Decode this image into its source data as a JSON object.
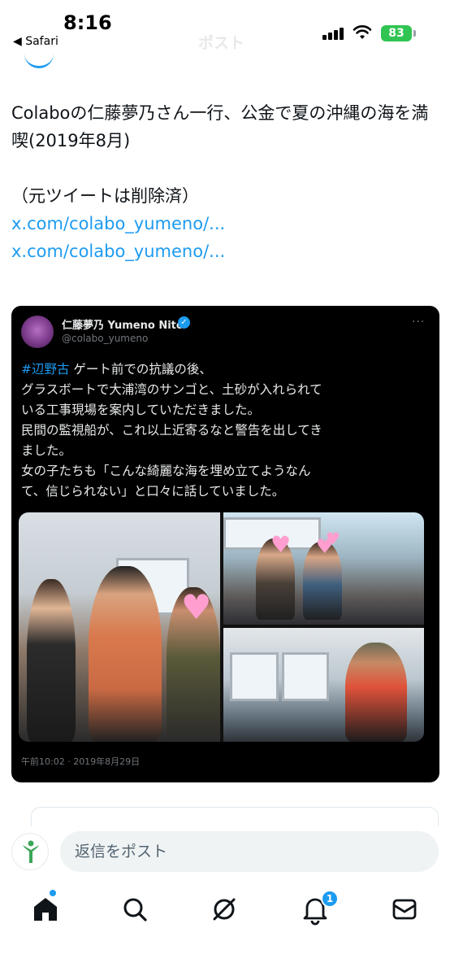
{
  "status_bar": {
    "time": "8:16",
    "back_app": "◀ Safari",
    "battery": "83"
  },
  "header": {
    "title": "ポスト"
  },
  "tweet": {
    "text_line1": "Colaboの仁藤夢乃さん一行、公金で夏の沖縄の海を満喫(2019年8月)",
    "text_line2": "（元ツイートは削除済）",
    "link1": "x.com/colabo_yumeno/...",
    "link2": "x.com/colabo_yumeno/..."
  },
  "embedded_tweet": {
    "name": "仁藤夢乃 Yumeno Nito",
    "handle": "@colabo_yumeno",
    "hashtag": "#辺野古",
    "line1_rest": " ゲート前での抗議の後、",
    "line2": "グラスボートで大浦湾のサンゴと、土砂が入れられて",
    "line3": "いる工事現場を案内していただきました。",
    "line4": "民間の監視船が、これ以上近寄るなと警告を出してき",
    "line5": "ました。",
    "line6": "女の子たちも「こんな綺麗な海を埋め立てようなん",
    "line7": "て、信じられない」と口々に話していました。",
    "timestamp": "午前10:02 · 2019年8月29日",
    "more": "···"
  },
  "reply": {
    "placeholder": "返信をポスト"
  },
  "tabbar": {
    "notification_count": "1"
  },
  "colors": {
    "accent": "#1d9bf0",
    "battery": "#30c552",
    "card_bg": "#000000"
  }
}
